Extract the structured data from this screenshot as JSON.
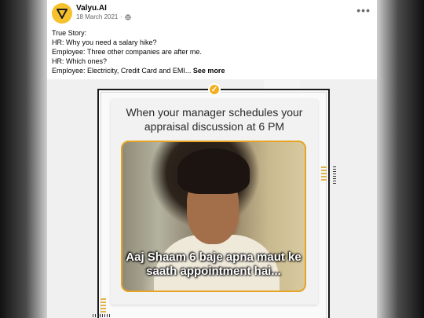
{
  "post": {
    "page_name": "Valyu.AI",
    "date": "18 March 2021",
    "separator": "·",
    "audience_icon": "globe-icon",
    "more_icon": "more-options-icon",
    "text_lines": [
      "True Story:",
      "HR: Why you need a salary hike?",
      "Employee: Three other companies are after me.",
      "HR: Which ones?",
      "Employee: Electricity, Credit Card and EMI..."
    ],
    "see_more": "See more"
  },
  "meme": {
    "caption_lines": [
      "When your manager schedules your",
      "appraisal discussion at 6 PM"
    ],
    "overlay_lines": [
      "Aaj Shaam 6 baje apna maut ke",
      "saath appointment hai..."
    ],
    "badge_icon": "check-badge-icon"
  },
  "colors": {
    "brand_yellow": "#f6c12d",
    "accent_orange": "#e6a325",
    "text_primary": "#050505",
    "text_secondary": "#65676b"
  }
}
